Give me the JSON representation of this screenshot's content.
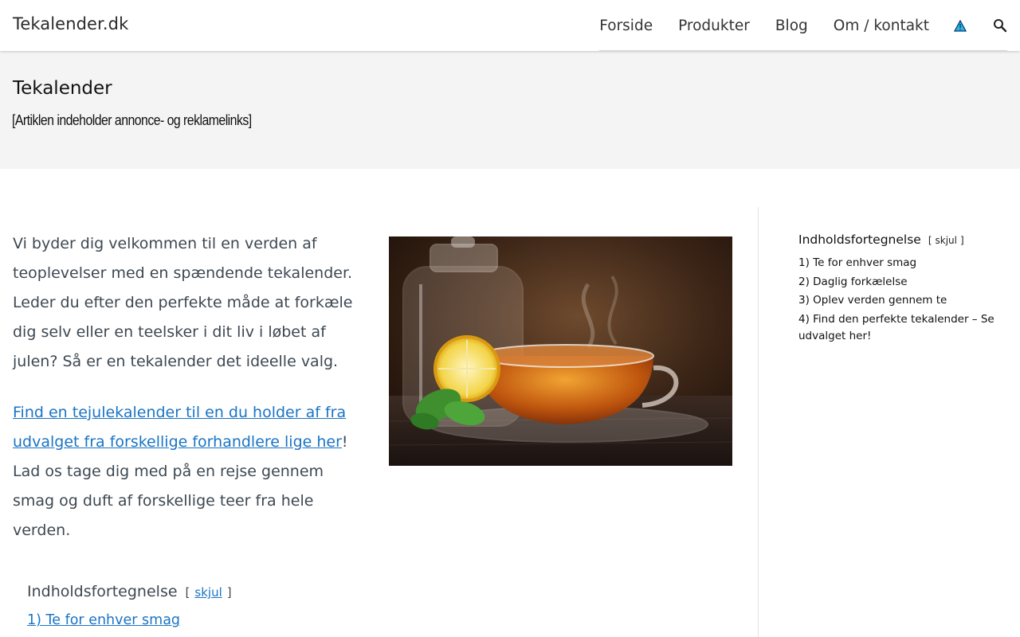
{
  "header": {
    "site_title": "Tekalender.dk",
    "nav": [
      "Forside",
      "Produkter",
      "Blog",
      "Om / kontakt"
    ],
    "icons": [
      "warning-triangle-icon",
      "search-icon"
    ]
  },
  "title_band": {
    "title": "Tekalender",
    "disclaimer": "[Artiklen indeholder annonce- og reklamelinks]"
  },
  "content": {
    "intro": "Vi byder dig velkommen til en verden af teoplevelser med en spændende tekalender. Leder du efter den perfekte måde at forkæle dig selv eller en teelsker i dit liv i løbet af julen? Så er en tekalender det ideelle valg.",
    "link_text": "Find en tejulekalender til en du holder af fra udvalget fra forskellige forhandlere lige her",
    "after_link_mark": "!",
    "after_link": "Lad os tage dig med på en rejse gennem smag og duft af forskellige teer fra hele verden.",
    "toc_title": "Indholdsfortegnelse",
    "toc_open": "[",
    "toc_toggle": "skjul",
    "toc_close": "]",
    "toc_first_item": "1) Te for enhver smag"
  },
  "sidebar": {
    "toc_title": "Indholdsfortegnelse",
    "toc_open": "[",
    "toc_toggle": "skjul",
    "toc_close": "]",
    "items": [
      "1) Te for enhver smag",
      "2) Daglig forkælelse",
      "3) Oplev verden gennem te",
      "4) Find den perfekte tekalender – Se udvalget her!"
    ]
  },
  "colors": {
    "link": "#1a74c4",
    "body_text": "#3d4852",
    "title_band_bg": "#f4f4f4",
    "warning_icon_fill": "#29b6e8"
  }
}
